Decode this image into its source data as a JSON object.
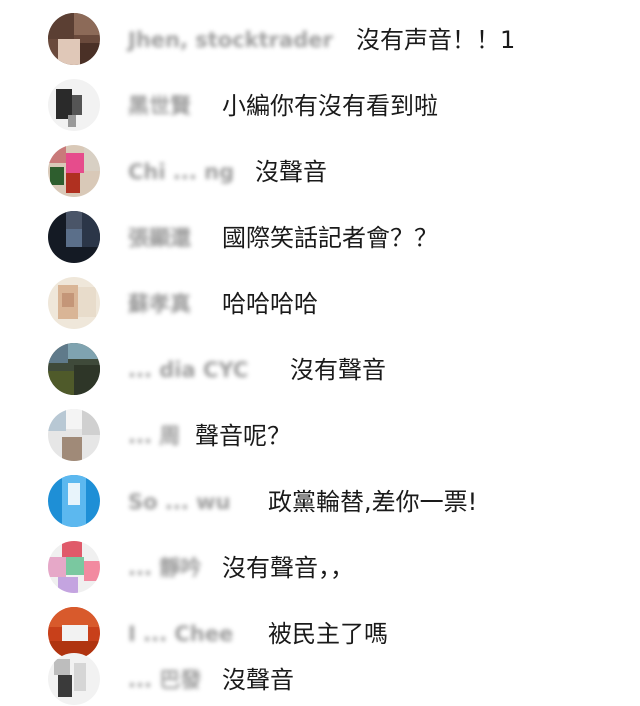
{
  "comments": [
    {
      "author": "Jhen, stocktrader",
      "message": "沒有声音！！1"
    },
    {
      "author": "黑世賢",
      "message": "小編你有沒有看到啦"
    },
    {
      "author": "Chi ... ng",
      "message": "沒聲音"
    },
    {
      "author": "張顯還",
      "message": "國際笑話記者會？？"
    },
    {
      "author": "蘇孝真",
      "message": "哈哈哈哈"
    },
    {
      "author": "... dia CYC",
      "message": "沒有聲音"
    },
    {
      "author": "... 周",
      "message": "聲音呢？"
    },
    {
      "author": "So ... wu",
      "message": "政黨輪替,差你一票!"
    },
    {
      "author": "... 靜吟",
      "message": "沒有聲音，，"
    },
    {
      "author": "I ... Chee",
      "message": "被民主了嗎"
    },
    {
      "author": "... 巴發",
      "message": "沒聲音"
    }
  ]
}
